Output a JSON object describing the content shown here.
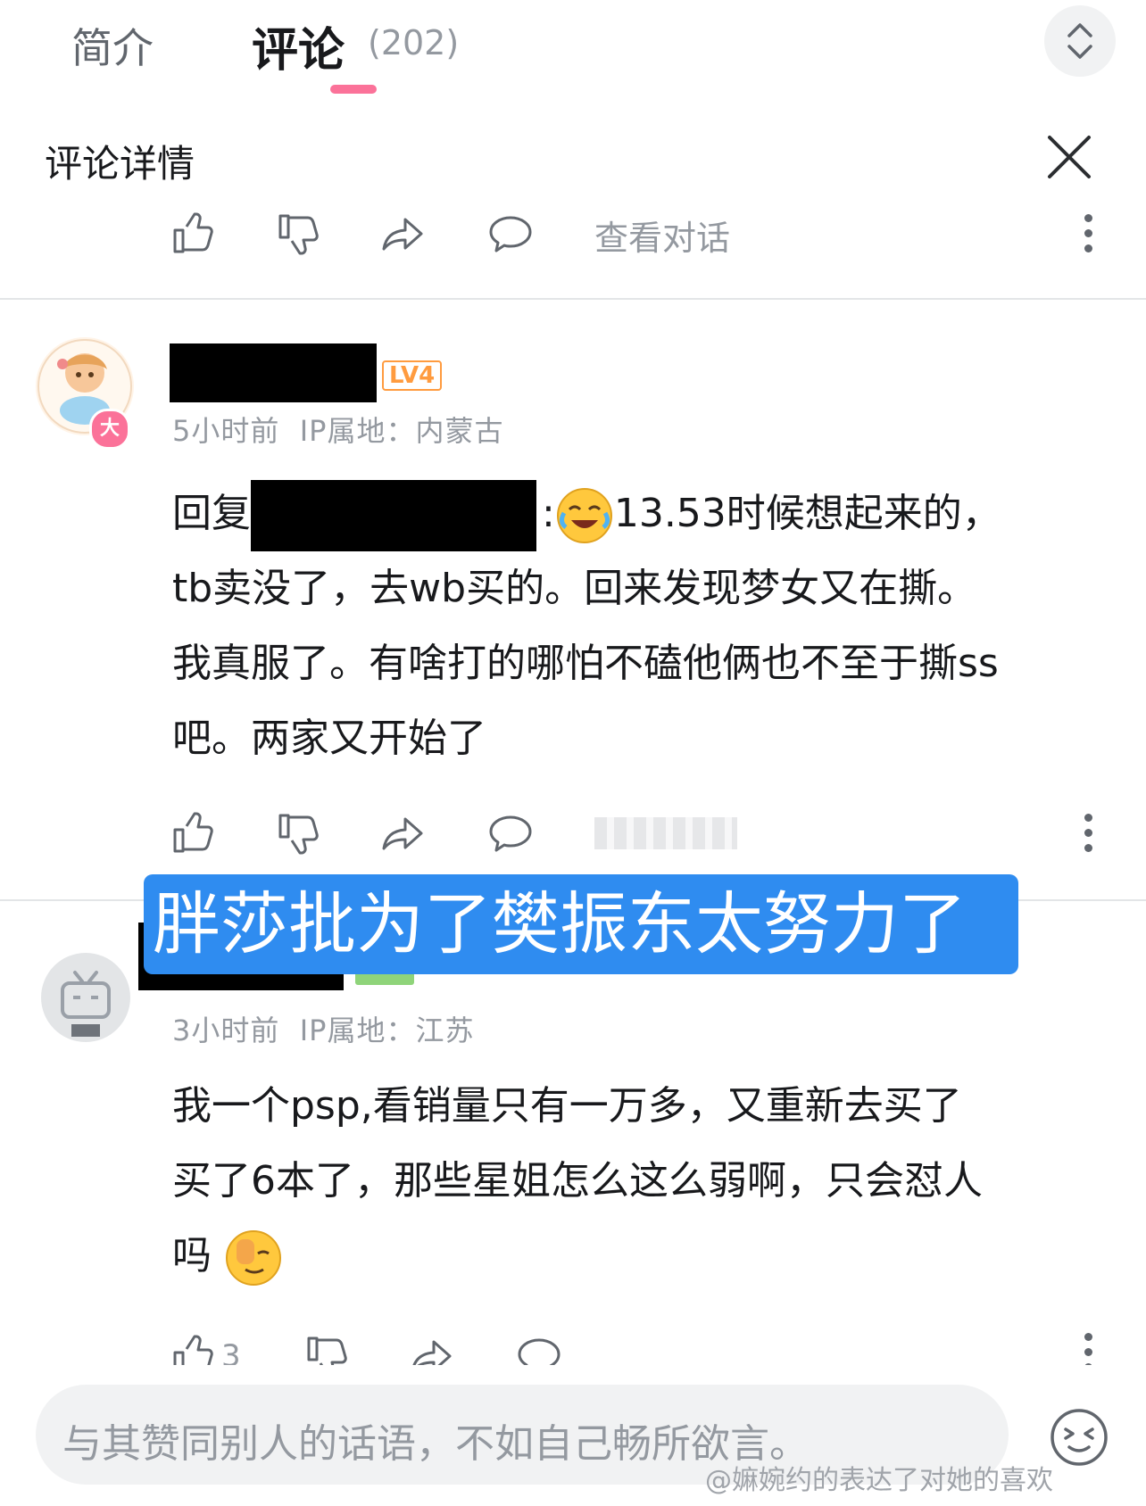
{
  "tabs": {
    "intro": "简介",
    "comments": "评论",
    "comments_count": "(202)"
  },
  "detail": {
    "title": "评论详情",
    "view_conversation": "查看对话"
  },
  "comment1": {
    "level": "LV4",
    "time": "5小时前",
    "ip": "IP属地：内蒙古",
    "reply_prefix": "回复",
    "line1": "13.53时候想起来的，",
    "line2": "tb卖没了，去wb买的。回来发现梦女又在撕。",
    "line3": "我真服了。有啥打的哪怕不磕他俩也不至于撕ss",
    "line4": "吧。两家又开始了"
  },
  "overlay_caption": "胖莎批为了樊振东太努力了",
  "comment2": {
    "time": "3小时前",
    "ip": "IP属地：江苏",
    "line1": "我一个psp,看销量只有一万多，又重新去买了",
    "line2": "买了6本了，那些星姐怎么这么弱啊，只会怼人",
    "line3": "吗",
    "like_count": "3"
  },
  "input": {
    "placeholder": "与其赞同别人的话语，不如自己畅所欲言。"
  },
  "watermark": "@嫲婉约的表达了对她的喜欢",
  "colors": {
    "accent_pink": "#fb7299",
    "caption_blue": "#2f8cf0",
    "level4_orange": "#ff9b3f",
    "muted_gray": "#9499a0"
  }
}
